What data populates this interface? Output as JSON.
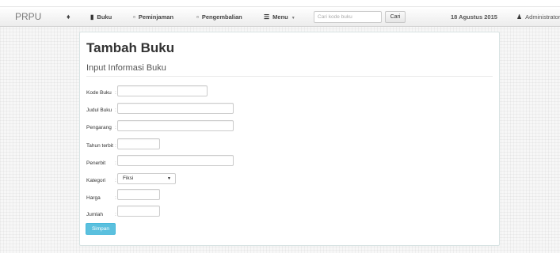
{
  "navbar": {
    "brand": "PRPU",
    "home_icon": "home-icon",
    "items": [
      {
        "label": "Buku",
        "icon": "book-icon"
      },
      {
        "label": "Peminjaman",
        "icon": "folder-open-icon"
      },
      {
        "label": "Pengembalian",
        "icon": "folder-open-icon"
      },
      {
        "label": "Menu",
        "icon": "list-icon"
      }
    ],
    "search_placeholder": "Cari kode buku",
    "search_button": "Cari",
    "date": "18 Agustus 2015",
    "user": "Administrator"
  },
  "form": {
    "title": "Tambah Buku",
    "subtitle": "Input Informasi Buku",
    "labels": {
      "kode": "Kode Buku",
      "judul": "Judul Buku",
      "pengarang": "Pengarang",
      "tahun": "Tahun terbit",
      "penerbit": "Penerbit",
      "kategori": "Kategori",
      "harga": "Harga",
      "jumlah": "Jumlah"
    },
    "colon": ":",
    "kategori_value": "Fiksi",
    "submit": "Simpan"
  },
  "colors": {
    "primary_button": "#5bc0de",
    "navbar_bg": "#f1f1f1",
    "panel_border": "#d8e3e3"
  }
}
